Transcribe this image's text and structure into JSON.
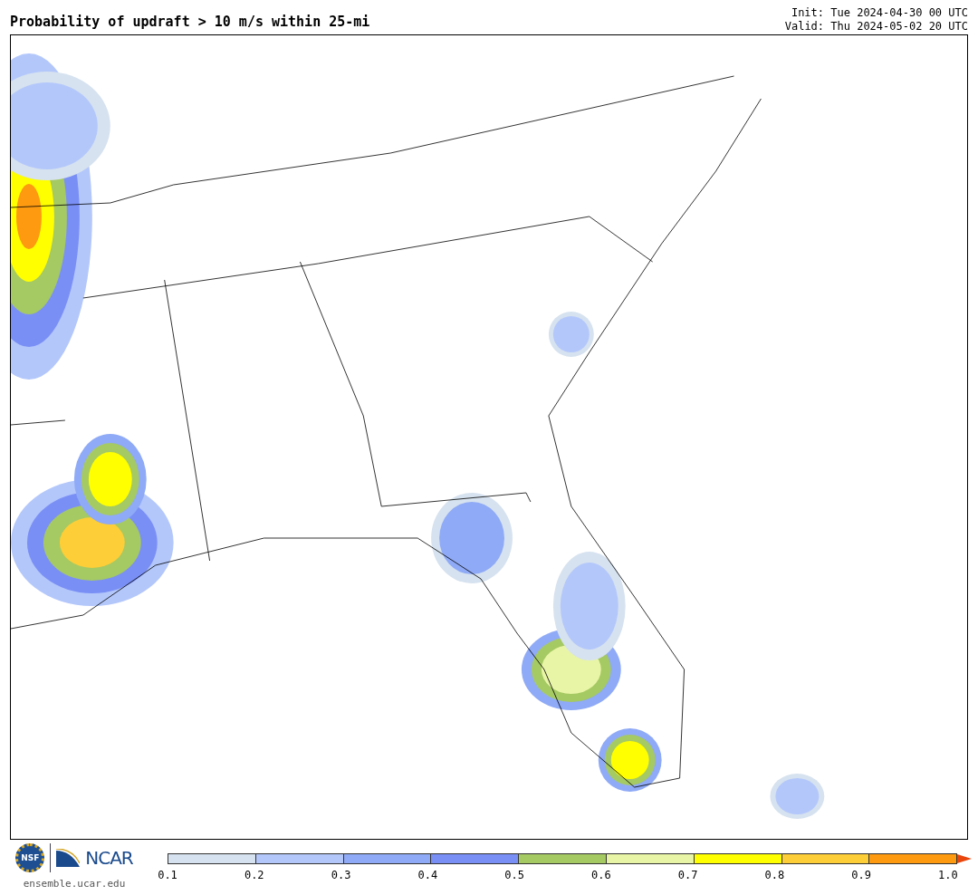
{
  "title": "Probability of updraft > 10 m/s within 25-mi",
  "init": "Init: Tue 2024-04-30 00 UTC",
  "valid": "Valid: Thu 2024-05-02 20 UTC",
  "logos": {
    "nsf": "NSF",
    "ncar": "NCAR",
    "site": "ensemble.ucar.edu"
  },
  "colorbar": {
    "segments": [
      {
        "color": "#d6e2ef"
      },
      {
        "color": "#b3c7fb"
      },
      {
        "color": "#8faaf6"
      },
      {
        "color": "#7a8ff5"
      },
      {
        "color": "#a5c963"
      },
      {
        "color": "#e9f5a6"
      },
      {
        "color": "#ffff00"
      },
      {
        "color": "#fdce37"
      },
      {
        "color": "#fd9a10"
      }
    ],
    "extend": {
      "color": "#e8460c"
    },
    "ticks": [
      "0.1",
      "0.2",
      "0.3",
      "0.4",
      "0.5",
      "0.6",
      "0.7",
      "0.8",
      "0.9",
      "1.0"
    ]
  }
}
